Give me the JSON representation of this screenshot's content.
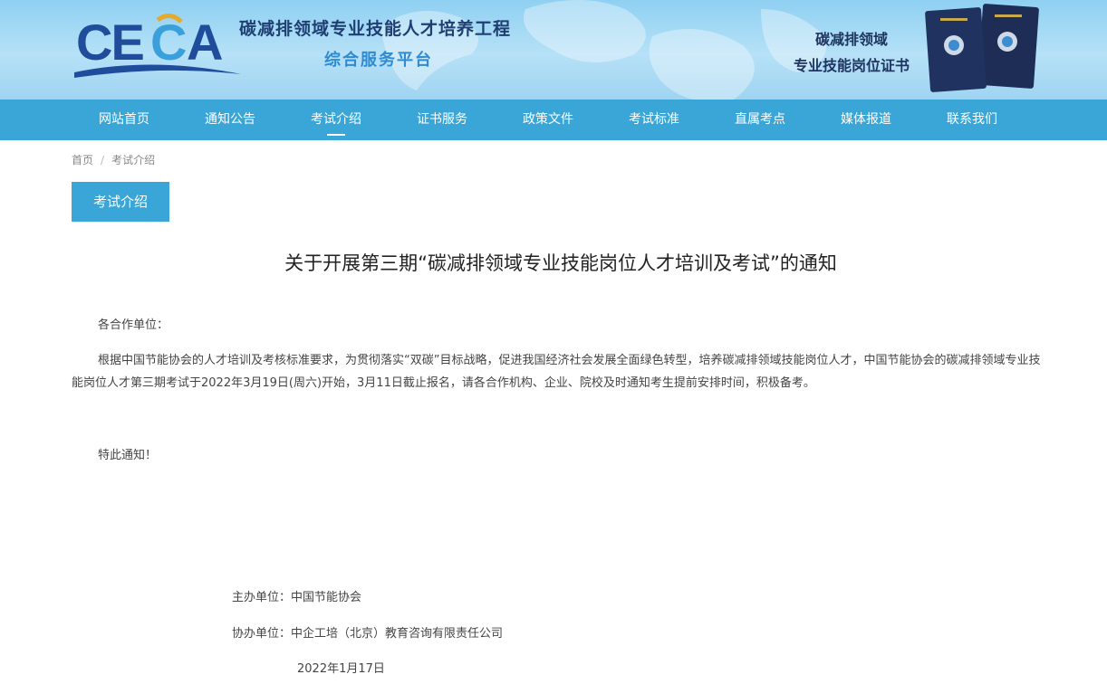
{
  "header": {
    "logo_text": "CECA",
    "title": "碳减排领域专业技能人才培养工程",
    "subtitle": "综合服务平台",
    "cert_line1": "碳减排领域",
    "cert_line2": "专业技能岗位证书"
  },
  "nav": {
    "items": [
      {
        "label": "网站首页"
      },
      {
        "label": "通知公告"
      },
      {
        "label": "考试介绍"
      },
      {
        "label": "证书服务"
      },
      {
        "label": "政策文件"
      },
      {
        "label": "考试标准"
      },
      {
        "label": "直属考点"
      },
      {
        "label": "媒体报道"
      },
      {
        "label": "联系我们"
      }
    ],
    "active": "考试介绍"
  },
  "breadcrumb": {
    "home": "首页",
    "separator": "/",
    "current": "考试介绍"
  },
  "section_tab": "考试介绍",
  "article": {
    "title": "关于开展第三期“碳减排领域专业技能岗位人才培训及考试”的通知",
    "salutation": "各合作单位：",
    "body": "根据中国节能协会的人才培训及考核标准要求，为贯彻落实“双碳”目标战略，促进我国经济社会发展全面绿色转型，培养碳减排领域技能岗位人才，中国节能协会的碳减排领域专业技能岗位人才第三期考试于2022年3月19日(周六)开始，3月11日截止报名，请各合作机构、企业、院校及时通知考生提前安排时间，积极备考。",
    "closing": "特此通知！",
    "organizer": "主办单位：中国节能协会",
    "co_organizer": "协办单位：中企工培（北京）教育咨询有限责任公司",
    "date": "2022年1月17日"
  },
  "colors": {
    "nav_bg": "#3aa6d8",
    "title_dark": "#1f3f73",
    "subtitle_blue": "#2f8bd3"
  }
}
